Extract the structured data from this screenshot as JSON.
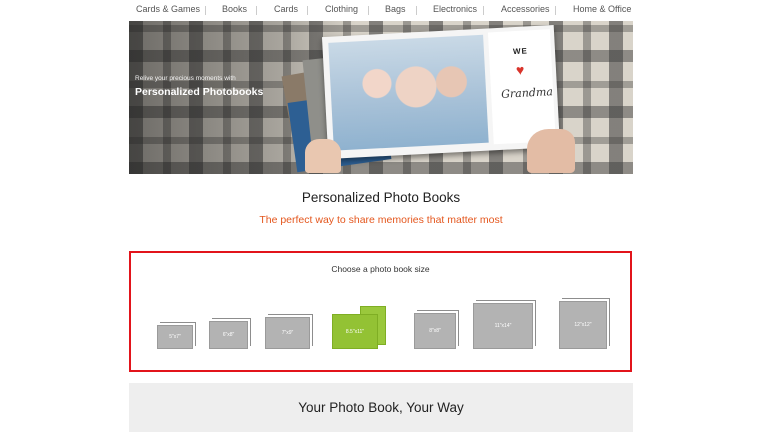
{
  "nav": {
    "items": [
      {
        "label": "Cards & Games"
      },
      {
        "label": "Books"
      },
      {
        "label": "Cards"
      },
      {
        "label": "Clothing"
      },
      {
        "label": "Bags"
      },
      {
        "label": "Electronics"
      },
      {
        "label": "Accessories"
      },
      {
        "label": "Home & Office"
      }
    ]
  },
  "hero": {
    "tagline": "Relive your precious moments with",
    "title": "Personalized Photobooks",
    "book_we": "WE",
    "book_grandma": "Grandma"
  },
  "page": {
    "title": "Personalized Photo Books",
    "subtitle": "The perfect way to share memories that matter most"
  },
  "size_chooser": {
    "title": "Choose a photo book size",
    "sizes": [
      {
        "label": "5\"x7\"",
        "selected": false
      },
      {
        "label": "6\"x8\"",
        "selected": false
      },
      {
        "label": "7\"x9\"",
        "selected": false
      },
      {
        "label": "8.5\"x11\"",
        "selected": true
      },
      {
        "label": "8\"x8\"",
        "selected": false
      },
      {
        "label": "11\"x14\"",
        "selected": false
      },
      {
        "label": "12\"x12\"",
        "selected": false
      }
    ]
  },
  "bottom": {
    "title": "Your Photo Book, Your Way"
  },
  "colors": {
    "accent_orange": "#e4571e",
    "highlight_red": "#e2141b",
    "selected_green": "#93c234",
    "book_gray": "#b3b3b3"
  }
}
